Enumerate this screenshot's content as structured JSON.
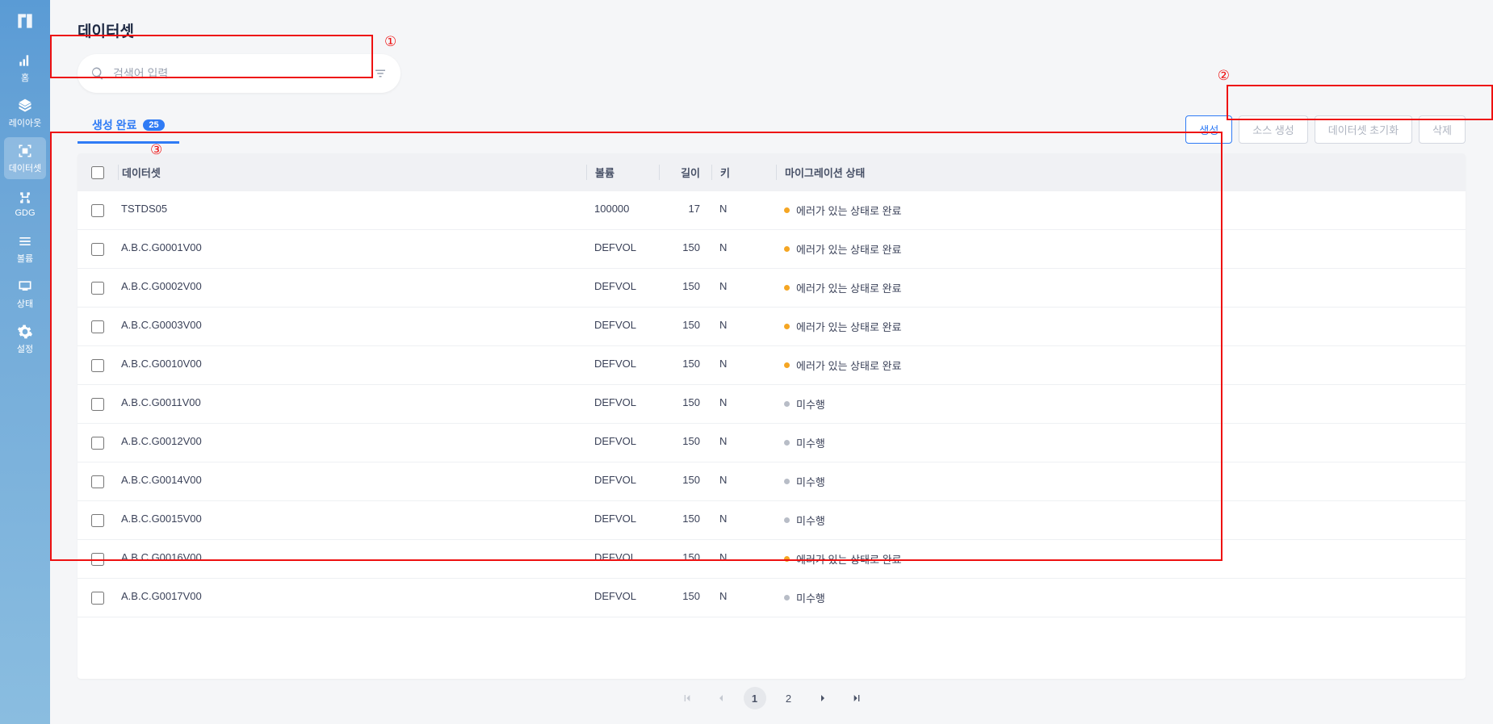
{
  "sidebar": {
    "items": [
      {
        "label": "홈",
        "icon": "home"
      },
      {
        "label": "레이아웃",
        "icon": "layout"
      },
      {
        "label": "데이터셋",
        "icon": "dataset"
      },
      {
        "label": "GDG",
        "icon": "gdg"
      },
      {
        "label": "볼륨",
        "icon": "volume"
      },
      {
        "label": "상태",
        "icon": "status"
      },
      {
        "label": "설정",
        "icon": "settings"
      }
    ]
  },
  "page": {
    "title": "데이터셋"
  },
  "search": {
    "placeholder": "검색어 입력"
  },
  "tabs": {
    "completed": {
      "label": "생성 완료",
      "count": "25"
    }
  },
  "buttons": {
    "create": "생성",
    "createSource": "소스 생성",
    "resetDataset": "데이터셋 초기화",
    "delete": "삭제"
  },
  "table": {
    "headers": {
      "dataset": "데이터셋",
      "volume": "볼륨",
      "length": "길이",
      "key": "키",
      "status": "마이그레이션 상태"
    },
    "rows": [
      {
        "dataset": "TSTDS05",
        "volume": "100000",
        "length": "17",
        "key": "N",
        "status": "에러가 있는 상태로 완료",
        "dot": "orange"
      },
      {
        "dataset": "A.B.C.G0001V00",
        "volume": "DEFVOL",
        "length": "150",
        "key": "N",
        "status": "에러가 있는 상태로 완료",
        "dot": "orange"
      },
      {
        "dataset": "A.B.C.G0002V00",
        "volume": "DEFVOL",
        "length": "150",
        "key": "N",
        "status": "에러가 있는 상태로 완료",
        "dot": "orange"
      },
      {
        "dataset": "A.B.C.G0003V00",
        "volume": "DEFVOL",
        "length": "150",
        "key": "N",
        "status": "에러가 있는 상태로 완료",
        "dot": "orange"
      },
      {
        "dataset": "A.B.C.G0010V00",
        "volume": "DEFVOL",
        "length": "150",
        "key": "N",
        "status": "에러가 있는 상태로 완료",
        "dot": "orange"
      },
      {
        "dataset": "A.B.C.G0011V00",
        "volume": "DEFVOL",
        "length": "150",
        "key": "N",
        "status": "미수행",
        "dot": "gray"
      },
      {
        "dataset": "A.B.C.G0012V00",
        "volume": "DEFVOL",
        "length": "150",
        "key": "N",
        "status": "미수행",
        "dot": "gray"
      },
      {
        "dataset": "A.B.C.G0014V00",
        "volume": "DEFVOL",
        "length": "150",
        "key": "N",
        "status": "미수행",
        "dot": "gray"
      },
      {
        "dataset": "A.B.C.G0015V00",
        "volume": "DEFVOL",
        "length": "150",
        "key": "N",
        "status": "미수행",
        "dot": "gray"
      },
      {
        "dataset": "A.B.C.G0016V00",
        "volume": "DEFVOL",
        "length": "150",
        "key": "N",
        "status": "에러가 있는 상태로 완료",
        "dot": "orange"
      },
      {
        "dataset": "A.B.C.G0017V00",
        "volume": "DEFVOL",
        "length": "150",
        "key": "N",
        "status": "미수행",
        "dot": "gray"
      }
    ]
  },
  "pagination": {
    "pages": [
      "1",
      "2"
    ],
    "active": "1"
  },
  "annotations": {
    "a1": "①",
    "a2": "②",
    "a3": "③"
  }
}
